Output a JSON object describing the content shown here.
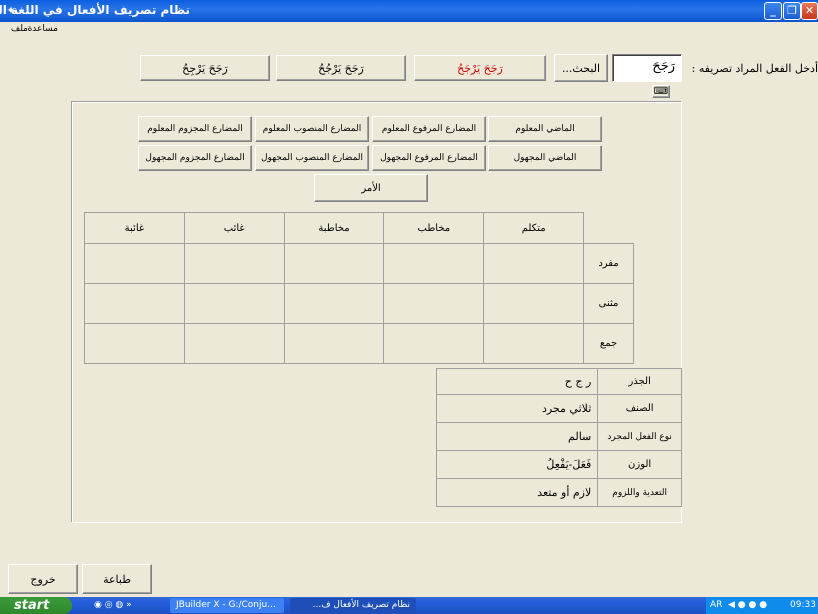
{
  "window": {
    "title": "نظام تصريف الأفعال في اللغة العربية",
    "minimize": "_",
    "maximize": "❐",
    "close": "✕"
  },
  "menu": {
    "items": [
      "ملف",
      "مساعدة"
    ]
  },
  "input": {
    "label": "أدخل الفعل المراد تصريفه :",
    "value": "رَجَحَ",
    "search_button": "البحث...",
    "keyboard_icon": "⌨"
  },
  "forms": [
    {
      "label": "رَجَحَ يَرْجَحُ",
      "selected": true
    },
    {
      "label": "رَجَحَ يَرْجُحُ",
      "selected": false
    },
    {
      "label": "رَجَحَ يَرْجِحُ",
      "selected": false
    }
  ],
  "tense_buttons": {
    "row1": [
      "الماضي المعلوم",
      "المضارع المرفوع المعلوم",
      "المضارع المنصوب المعلوم",
      "المضارع المجزوم المعلوم"
    ],
    "row2": [
      "الماضي المجهول",
      "المضارع المرفوع المجهول",
      "المضارع المنصوب المجهول",
      "المضارع المجزوم المجهول"
    ],
    "imperative": "الأمر"
  },
  "conjugation_table": {
    "columns": [
      "متكلم",
      "مخاطب",
      "مخاطبة",
      "غائب",
      "غائبة"
    ],
    "rows": [
      "مفرد",
      "مثنى",
      "جمع"
    ]
  },
  "info": [
    {
      "label": "الجذر",
      "value": "ر ج ح"
    },
    {
      "label": "الصنف",
      "value": "ثلاثي مجرد"
    },
    {
      "label": "نوع الفعل المجرد",
      "value": "سالم"
    },
    {
      "label": "الوزن",
      "value": "فَعَلَ-يَفْعِلُ"
    },
    {
      "label": "التعدية واللزوم",
      "value": "لازم أو متعد"
    }
  ],
  "bottom_buttons": {
    "print": "طباعة",
    "exit": "خروج"
  },
  "taskbar": {
    "start": "start",
    "tasks": [
      "JBuilder X - G:/Conju...",
      "نظام تصريف الأفعال ف..."
    ],
    "lang": "AR",
    "clock": "09:33"
  }
}
